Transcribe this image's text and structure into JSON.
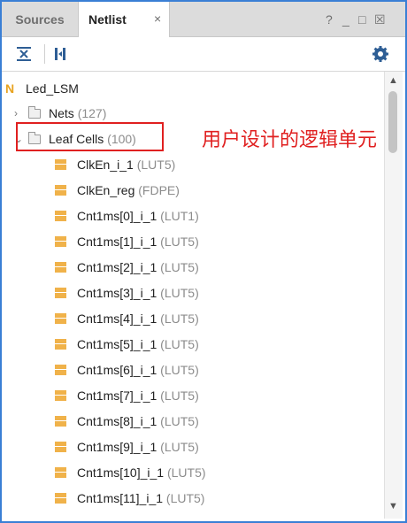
{
  "tabs": {
    "sources": "Sources",
    "netlist": "Netlist"
  },
  "window_controls": {
    "help": "?",
    "minimize": "_",
    "restore": "□",
    "close_panel": "☒",
    "tab_close": "×"
  },
  "tree": {
    "root": {
      "label": "Led_LSM",
      "icon": "N"
    },
    "nets": {
      "label": "Nets",
      "count": "(127)"
    },
    "leaf_cells": {
      "label": "Leaf Cells",
      "count": "(100)"
    },
    "cells": [
      {
        "name": "ClkEn_i_1",
        "type": "(LUT5)"
      },
      {
        "name": "ClkEn_reg",
        "type": "(FDPE)"
      },
      {
        "name": "Cnt1ms[0]_i_1",
        "type": "(LUT1)"
      },
      {
        "name": "Cnt1ms[1]_i_1",
        "type": "(LUT5)"
      },
      {
        "name": "Cnt1ms[2]_i_1",
        "type": "(LUT5)"
      },
      {
        "name": "Cnt1ms[3]_i_1",
        "type": "(LUT5)"
      },
      {
        "name": "Cnt1ms[4]_i_1",
        "type": "(LUT5)"
      },
      {
        "name": "Cnt1ms[5]_i_1",
        "type": "(LUT5)"
      },
      {
        "name": "Cnt1ms[6]_i_1",
        "type": "(LUT5)"
      },
      {
        "name": "Cnt1ms[7]_i_1",
        "type": "(LUT5)"
      },
      {
        "name": "Cnt1ms[8]_i_1",
        "type": "(LUT5)"
      },
      {
        "name": "Cnt1ms[9]_i_1",
        "type": "(LUT5)"
      },
      {
        "name": "Cnt1ms[10]_i_1",
        "type": "(LUT5)"
      },
      {
        "name": "Cnt1ms[11]_i_1",
        "type": "(LUT5)"
      }
    ]
  },
  "annotation": "用户设计的逻辑单元",
  "colors": {
    "accent_border": "#3a7fd5",
    "annotation": "#e02020",
    "lut_icon": "#f0b24a",
    "toolbar_icon": "#2e5e95"
  }
}
